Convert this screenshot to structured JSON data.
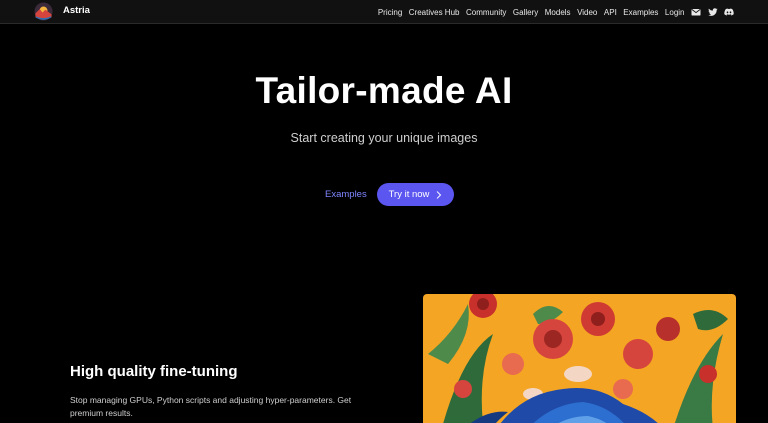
{
  "nav": {
    "brand": "Astria",
    "items": [
      {
        "label": "Pricing",
        "name": "nav-pricing"
      },
      {
        "label": "Creatives Hub",
        "name": "nav-creatives-hub"
      },
      {
        "label": "Community",
        "name": "nav-community"
      },
      {
        "label": "Gallery",
        "name": "nav-gallery"
      },
      {
        "label": "Models",
        "name": "nav-models"
      },
      {
        "label": "Video",
        "name": "nav-video"
      },
      {
        "label": "API",
        "name": "nav-api"
      },
      {
        "label": "Examples",
        "name": "nav-examples"
      },
      {
        "label": "Login",
        "name": "nav-login"
      }
    ],
    "icons": [
      "mail-icon",
      "twitter-icon",
      "discord-icon"
    ]
  },
  "hero": {
    "title": "Tailor-made AI",
    "subtitle": "Start creating your unique images",
    "examples_label": "Examples",
    "cta_label": "Try it now"
  },
  "feature": {
    "title": "High quality fine-tuning",
    "text": "Stop managing GPUs, Python scripts and adjusting hyper-parameters. Get premium results."
  },
  "colors": {
    "accent": "#5b56f0",
    "link": "#7f86ff",
    "art_background": "#f5a524"
  }
}
